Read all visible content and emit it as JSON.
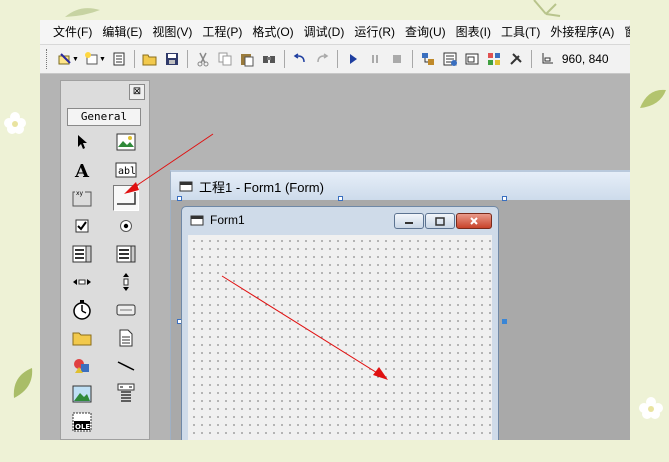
{
  "menubar": {
    "items": [
      "文件(F)",
      "编辑(E)",
      "视图(V)",
      "工程(P)",
      "格式(O)",
      "调试(D)",
      "运行(R)",
      "查询(U)",
      "图表(I)",
      "工具(T)",
      "外接程序(A)",
      "窗"
    ]
  },
  "toolbar": {
    "coordinates": "960, 840",
    "icons": [
      "add-project-icon",
      "add-form-icon",
      "menu-editor-icon",
      "open-icon",
      "save-icon",
      "cut-icon",
      "copy-icon",
      "paste-icon",
      "find-icon",
      "undo-icon",
      "redo-icon",
      "start-icon",
      "break-icon",
      "end-icon",
      "project-explorer-icon",
      "properties-window-icon",
      "form-layout-icon",
      "object-browser-icon",
      "toolbox-icon",
      "position-icon"
    ]
  },
  "toolbox": {
    "close_label": "⊠",
    "tab_label": "General",
    "tools": [
      "pointer",
      "picturebox",
      "label",
      "textbox",
      "frame",
      "commandbutton",
      "checkbox",
      "optionbutton",
      "combobox",
      "listbox",
      "hscrollbar",
      "vscrollbar",
      "timer",
      "drivelistbox",
      "dirlistbox",
      "filelistbox",
      "shape",
      "line",
      "image",
      "data",
      "ole"
    ],
    "textbox_glyph": "abl",
    "frame_glyph": "xy",
    "ole_glyph": "OLE"
  },
  "project_window": {
    "title": "工程1 - Form1 (Form)"
  },
  "form1": {
    "title": "Form1"
  },
  "colors": {
    "arrow": "#e01010",
    "background": "#eef2d6",
    "workspace": "#b4b4b4"
  }
}
